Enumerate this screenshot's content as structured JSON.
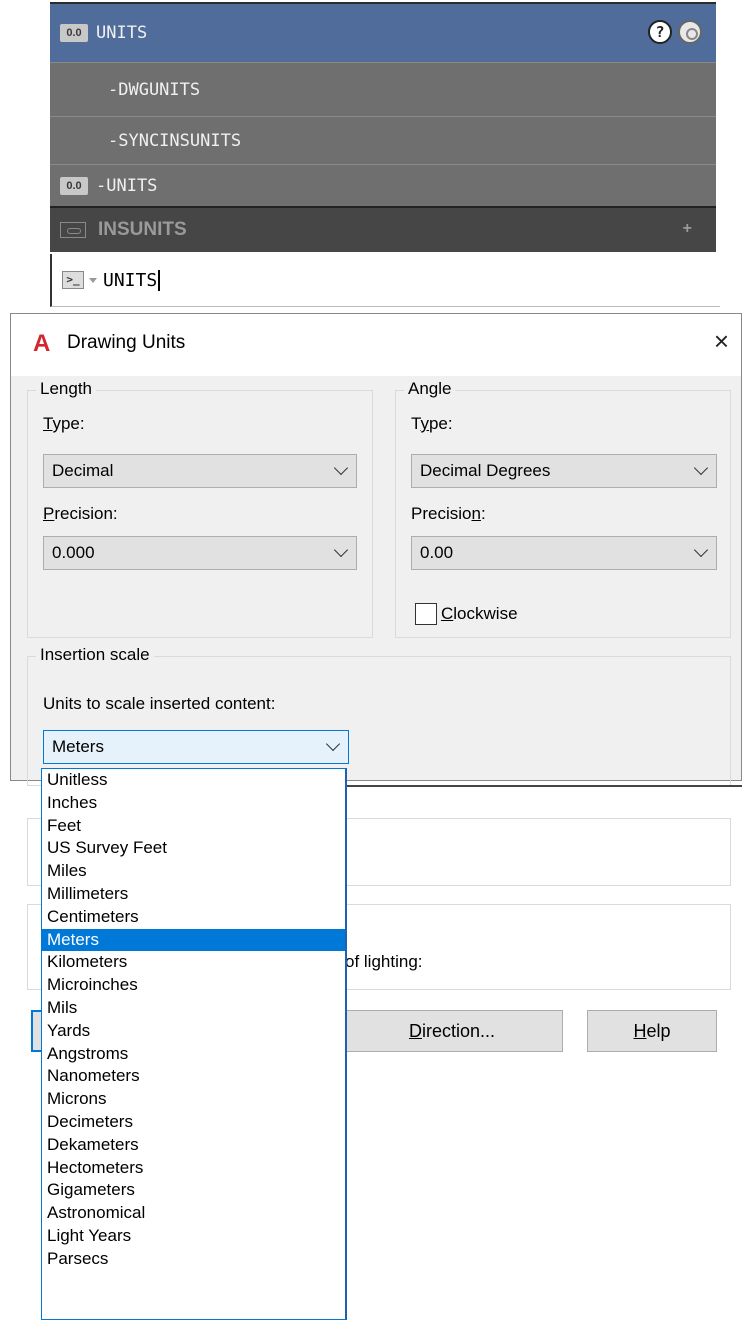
{
  "autocomplete": {
    "items": [
      {
        "label": "UNITS",
        "icon": "value-00-icon",
        "highlighted": true
      },
      {
        "label": "-DWGUNITS"
      },
      {
        "label": "-SYNCINSUNITS"
      },
      {
        "label": "-UNITS",
        "icon": "value-00-icon"
      }
    ],
    "sysvar": {
      "label": "INSUNITS",
      "icon": "sysvar-icon",
      "expand_icon": "plus-icon"
    },
    "icon_text": "0.0",
    "help_icon_text": "?"
  },
  "command_line": {
    "prompt_icon_text": ">_",
    "text": "UNITS"
  },
  "dialog": {
    "title": "Drawing Units",
    "logo_text": "A",
    "close_label": "×",
    "length": {
      "legend": "Length",
      "type_label": "Type:",
      "type_value": "Decimal",
      "precision_label": "Precision:",
      "precision_value": "0.000"
    },
    "angle": {
      "legend": "Angle",
      "type_label": "Type:",
      "type_value": "Decimal Degrees",
      "precision_label": "Precision:",
      "precision_value": "0.00",
      "clockwise_label": "Clockwise",
      "clockwise_checked": false
    },
    "insertion": {
      "legend": "Insertion scale",
      "units_label": "Units to scale inserted content:",
      "units_value": "Meters"
    },
    "lighting_fragment": "of lighting:",
    "buttons": {
      "direction": "Direction...",
      "help": "Help"
    }
  },
  "dropdown": {
    "selected": "Meters",
    "options": [
      "Unitless",
      "Inches",
      "Feet",
      "US Survey Feet",
      "Miles",
      "Millimeters",
      "Centimeters",
      "Meters",
      "Kilometers",
      "Microinches",
      "Mils",
      "Yards",
      "Angstroms",
      "Nanometers",
      "Microns",
      "Decimeters",
      "Dekameters",
      "Hectometers",
      "Gigameters",
      "Astronomical",
      "Light Years",
      "Parsecs"
    ]
  }
}
